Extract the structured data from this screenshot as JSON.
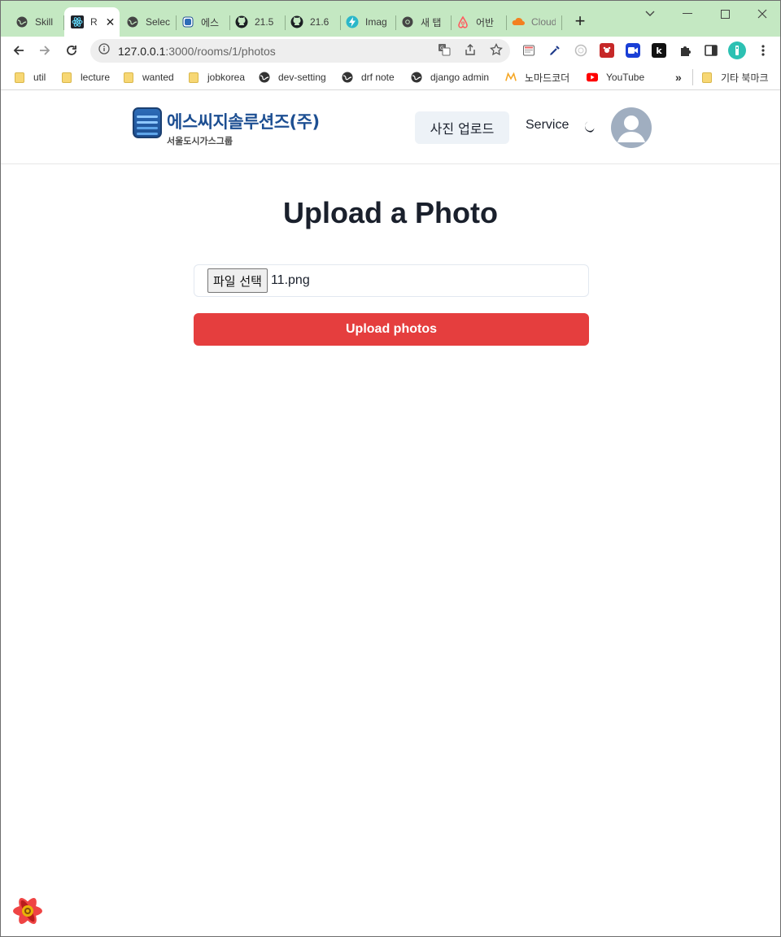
{
  "browser": {
    "tabs": [
      {
        "label": "Skill",
        "icon": "globe-icon"
      },
      {
        "label": "R",
        "icon": "react-icon",
        "active": true
      },
      {
        "label": "Selec",
        "icon": "globe-icon"
      },
      {
        "label": "에스",
        "icon": "app-icon"
      },
      {
        "label": "21.5",
        "icon": "github-icon"
      },
      {
        "label": "21.6",
        "icon": "github-icon"
      },
      {
        "label": "Imag",
        "icon": "bolt-icon"
      },
      {
        "label": "새 탭",
        "icon": "chrome-icon"
      },
      {
        "label": "어반",
        "icon": "airbnb-icon"
      },
      {
        "label": "Cloud",
        "icon": "cloudflare-icon"
      }
    ],
    "url_host": "127.0.0.1",
    "url_path": ":3000/rooms/1/photos",
    "bookmarks": [
      {
        "label": "util",
        "icon": "folder-icon"
      },
      {
        "label": "lecture",
        "icon": "folder-icon"
      },
      {
        "label": "wanted",
        "icon": "folder-icon"
      },
      {
        "label": "jobkorea",
        "icon": "folder-icon"
      },
      {
        "label": "dev-setting",
        "icon": "globe-icon"
      },
      {
        "label": "drf note",
        "icon": "globe-icon"
      },
      {
        "label": "django admin",
        "icon": "globe-icon"
      },
      {
        "label": "노마드코더",
        "icon": "nomad-icon"
      },
      {
        "label": "YouTube",
        "icon": "youtube-icon"
      }
    ],
    "bookmarks_more": "»",
    "other_bookmarks": "기타 북마크"
  },
  "header": {
    "logo_name": "에스씨지솔루션즈(주)",
    "logo_sub": "서울도시가스그룹",
    "upload_button": "사진 업로드",
    "service_link": "Service"
  },
  "main": {
    "title": "Upload a Photo",
    "file_button": "파일 선택",
    "file_name": "11.png",
    "submit_button": "Upload photos"
  },
  "colors": {
    "tabbar": "#c4e8c2",
    "submit": "#e53e3e",
    "brand": "#1d4f92"
  }
}
